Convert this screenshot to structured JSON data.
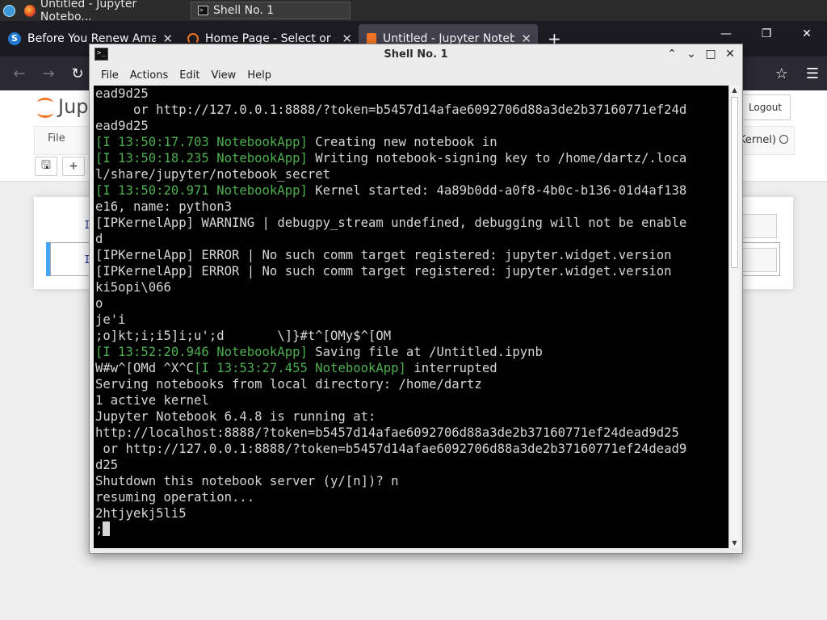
{
  "taskbar": {
    "tasks": [
      {
        "label": "Untitled - Jupyter Notebo..."
      },
      {
        "label": "Shell No. 1"
      }
    ]
  },
  "browser": {
    "tabs": [
      {
        "label": "Before You Renew Amaz"
      },
      {
        "label": "Home Page - Select or cr"
      },
      {
        "label": "Untitled - Jupyter Noteb"
      }
    ],
    "newtab_symbol": "+",
    "window_controls": {
      "minimize": "—",
      "maximize": "❐",
      "close": "✕"
    },
    "nav": {
      "back": "←",
      "forward": "→",
      "reload": "↻",
      "star": "☆",
      "menu": "☰"
    }
  },
  "jupyter": {
    "logo_text": "Jupy",
    "logout_label": "Logout",
    "menu_file": "File",
    "kernel_status": "Kernel)",
    "toolbar": {
      "save": "🖫",
      "add": "+"
    },
    "cell_prompts": [
      "In",
      "In"
    ]
  },
  "terminal": {
    "title": "Shell No. 1",
    "icon_text": ">_",
    "controls": {
      "up": "⌃",
      "down": "⌄",
      "maximize": "□",
      "close": "✕"
    },
    "menu": [
      "File",
      "Actions",
      "Edit",
      "View",
      "Help"
    ],
    "lines": [
      {
        "text": "ead9d25"
      },
      {
        "text": "     or http://127.0.0.1:8888/?token=b5457d14afae6092706d88a3de2b37160771ef24d"
      },
      {
        "text": "ead9d25"
      },
      {
        "green": "[I 13:50:17.703 NotebookApp]",
        "text": " Creating new notebook in"
      },
      {
        "green": "[I 13:50:18.235 NotebookApp]",
        "text": " Writing notebook-signing key to /home/dartz/.loca"
      },
      {
        "text": "l/share/jupyter/notebook_secret"
      },
      {
        "green": "[I 13:50:20.971 NotebookApp]",
        "text": " Kernel started: 4a89b0dd-a0f8-4b0c-b136-01d4af138"
      },
      {
        "text": "e16, name: python3"
      },
      {
        "text": "[IPKernelApp] WARNING | debugpy_stream undefined, debugging will not be enable"
      },
      {
        "text": "d"
      },
      {
        "text": "[IPKernelApp] ERROR | No such comm target registered: jupyter.widget.version"
      },
      {
        "text": "[IPKernelApp] ERROR | No such comm target registered: jupyter.widget.version"
      },
      {
        "text": "ki5opi\\066"
      },
      {
        "text": "o"
      },
      {
        "text": "je'i"
      },
      {
        "text": ";o]kt;i;i5]i;u';d       \\]}#t^[OMy$^[OM"
      },
      {
        "green": "[I 13:52:20.946 NotebookApp]",
        "text": " Saving file at /Untitled.ipynb"
      },
      {
        "prefix": "W#w^[OMd ^X^C",
        "green": "[I 13:53:27.455 NotebookApp]",
        "text": " interrupted"
      },
      {
        "text": "Serving notebooks from local directory: /home/dartz"
      },
      {
        "text": "1 active kernel"
      },
      {
        "text": "Jupyter Notebook 6.4.8 is running at:"
      },
      {
        "text": "http://localhost:8888/?token=b5457d14afae6092706d88a3de2b37160771ef24dead9d25"
      },
      {
        "text": " or http://127.0.0.1:8888/?token=b5457d14afae6092706d88a3de2b37160771ef24dead9"
      },
      {
        "text": "d25"
      },
      {
        "text": "Shutdown this notebook server (y/[n])? n"
      },
      {
        "text": "resuming operation..."
      },
      {
        "text": "2htjyekj5li5"
      },
      {
        "text": ";",
        "cursor": true
      }
    ],
    "scroll_up": "▲",
    "scroll_down": "▼"
  }
}
